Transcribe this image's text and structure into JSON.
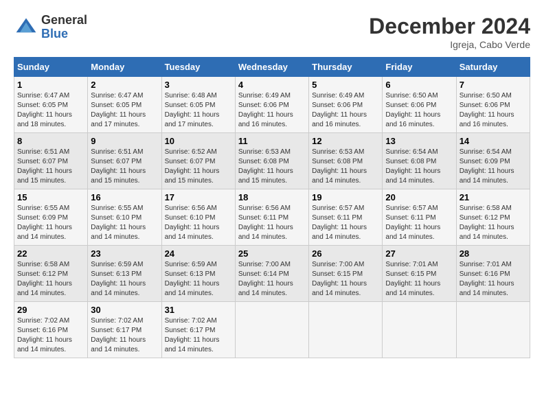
{
  "header": {
    "logo_general": "General",
    "logo_blue": "Blue",
    "month_title": "December 2024",
    "subtitle": "Igreja, Cabo Verde"
  },
  "days_of_week": [
    "Sunday",
    "Monday",
    "Tuesday",
    "Wednesday",
    "Thursday",
    "Friday",
    "Saturday"
  ],
  "weeks": [
    [
      {
        "day": "1",
        "sunrise": "Sunrise: 6:47 AM",
        "sunset": "Sunset: 6:05 PM",
        "daylight": "Daylight: 11 hours and 18 minutes."
      },
      {
        "day": "2",
        "sunrise": "Sunrise: 6:47 AM",
        "sunset": "Sunset: 6:05 PM",
        "daylight": "Daylight: 11 hours and 17 minutes."
      },
      {
        "day": "3",
        "sunrise": "Sunrise: 6:48 AM",
        "sunset": "Sunset: 6:05 PM",
        "daylight": "Daylight: 11 hours and 17 minutes."
      },
      {
        "day": "4",
        "sunrise": "Sunrise: 6:49 AM",
        "sunset": "Sunset: 6:06 PM",
        "daylight": "Daylight: 11 hours and 16 minutes."
      },
      {
        "day": "5",
        "sunrise": "Sunrise: 6:49 AM",
        "sunset": "Sunset: 6:06 PM",
        "daylight": "Daylight: 11 hours and 16 minutes."
      },
      {
        "day": "6",
        "sunrise": "Sunrise: 6:50 AM",
        "sunset": "Sunset: 6:06 PM",
        "daylight": "Daylight: 11 hours and 16 minutes."
      },
      {
        "day": "7",
        "sunrise": "Sunrise: 6:50 AM",
        "sunset": "Sunset: 6:06 PM",
        "daylight": "Daylight: 11 hours and 16 minutes."
      }
    ],
    [
      {
        "day": "8",
        "sunrise": "Sunrise: 6:51 AM",
        "sunset": "Sunset: 6:07 PM",
        "daylight": "Daylight: 11 hours and 15 minutes."
      },
      {
        "day": "9",
        "sunrise": "Sunrise: 6:51 AM",
        "sunset": "Sunset: 6:07 PM",
        "daylight": "Daylight: 11 hours and 15 minutes."
      },
      {
        "day": "10",
        "sunrise": "Sunrise: 6:52 AM",
        "sunset": "Sunset: 6:07 PM",
        "daylight": "Daylight: 11 hours and 15 minutes."
      },
      {
        "day": "11",
        "sunrise": "Sunrise: 6:53 AM",
        "sunset": "Sunset: 6:08 PM",
        "daylight": "Daylight: 11 hours and 15 minutes."
      },
      {
        "day": "12",
        "sunrise": "Sunrise: 6:53 AM",
        "sunset": "Sunset: 6:08 PM",
        "daylight": "Daylight: 11 hours and 14 minutes."
      },
      {
        "day": "13",
        "sunrise": "Sunrise: 6:54 AM",
        "sunset": "Sunset: 6:08 PM",
        "daylight": "Daylight: 11 hours and 14 minutes."
      },
      {
        "day": "14",
        "sunrise": "Sunrise: 6:54 AM",
        "sunset": "Sunset: 6:09 PM",
        "daylight": "Daylight: 11 hours and 14 minutes."
      }
    ],
    [
      {
        "day": "15",
        "sunrise": "Sunrise: 6:55 AM",
        "sunset": "Sunset: 6:09 PM",
        "daylight": "Daylight: 11 hours and 14 minutes."
      },
      {
        "day": "16",
        "sunrise": "Sunrise: 6:55 AM",
        "sunset": "Sunset: 6:10 PM",
        "daylight": "Daylight: 11 hours and 14 minutes."
      },
      {
        "day": "17",
        "sunrise": "Sunrise: 6:56 AM",
        "sunset": "Sunset: 6:10 PM",
        "daylight": "Daylight: 11 hours and 14 minutes."
      },
      {
        "day": "18",
        "sunrise": "Sunrise: 6:56 AM",
        "sunset": "Sunset: 6:11 PM",
        "daylight": "Daylight: 11 hours and 14 minutes."
      },
      {
        "day": "19",
        "sunrise": "Sunrise: 6:57 AM",
        "sunset": "Sunset: 6:11 PM",
        "daylight": "Daylight: 11 hours and 14 minutes."
      },
      {
        "day": "20",
        "sunrise": "Sunrise: 6:57 AM",
        "sunset": "Sunset: 6:11 PM",
        "daylight": "Daylight: 11 hours and 14 minutes."
      },
      {
        "day": "21",
        "sunrise": "Sunrise: 6:58 AM",
        "sunset": "Sunset: 6:12 PM",
        "daylight": "Daylight: 11 hours and 14 minutes."
      }
    ],
    [
      {
        "day": "22",
        "sunrise": "Sunrise: 6:58 AM",
        "sunset": "Sunset: 6:12 PM",
        "daylight": "Daylight: 11 hours and 14 minutes."
      },
      {
        "day": "23",
        "sunrise": "Sunrise: 6:59 AM",
        "sunset": "Sunset: 6:13 PM",
        "daylight": "Daylight: 11 hours and 14 minutes."
      },
      {
        "day": "24",
        "sunrise": "Sunrise: 6:59 AM",
        "sunset": "Sunset: 6:13 PM",
        "daylight": "Daylight: 11 hours and 14 minutes."
      },
      {
        "day": "25",
        "sunrise": "Sunrise: 7:00 AM",
        "sunset": "Sunset: 6:14 PM",
        "daylight": "Daylight: 11 hours and 14 minutes."
      },
      {
        "day": "26",
        "sunrise": "Sunrise: 7:00 AM",
        "sunset": "Sunset: 6:15 PM",
        "daylight": "Daylight: 11 hours and 14 minutes."
      },
      {
        "day": "27",
        "sunrise": "Sunrise: 7:01 AM",
        "sunset": "Sunset: 6:15 PM",
        "daylight": "Daylight: 11 hours and 14 minutes."
      },
      {
        "day": "28",
        "sunrise": "Sunrise: 7:01 AM",
        "sunset": "Sunset: 6:16 PM",
        "daylight": "Daylight: 11 hours and 14 minutes."
      }
    ],
    [
      {
        "day": "29",
        "sunrise": "Sunrise: 7:02 AM",
        "sunset": "Sunset: 6:16 PM",
        "daylight": "Daylight: 11 hours and 14 minutes."
      },
      {
        "day": "30",
        "sunrise": "Sunrise: 7:02 AM",
        "sunset": "Sunset: 6:17 PM",
        "daylight": "Daylight: 11 hours and 14 minutes."
      },
      {
        "day": "31",
        "sunrise": "Sunrise: 7:02 AM",
        "sunset": "Sunset: 6:17 PM",
        "daylight": "Daylight: 11 hours and 14 minutes."
      },
      null,
      null,
      null,
      null
    ]
  ]
}
